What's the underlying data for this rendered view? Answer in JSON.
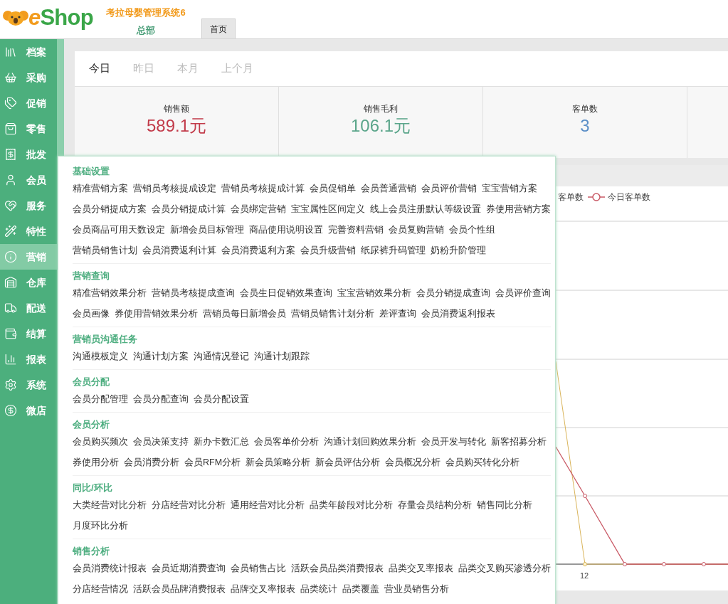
{
  "header": {
    "logo": {
      "accent": "e",
      "name": "Shop"
    },
    "system_title": "考拉母婴管理系统6",
    "branch": "总部",
    "tabs": [
      {
        "label": "首页",
        "selected": true
      }
    ]
  },
  "sidebar": {
    "items": [
      {
        "label": "档案",
        "selected": false
      },
      {
        "label": "采购",
        "selected": false
      },
      {
        "label": "促销",
        "selected": false
      },
      {
        "label": "零售",
        "selected": false
      },
      {
        "label": "批发",
        "selected": false
      },
      {
        "label": "会员",
        "selected": false
      },
      {
        "label": "服务",
        "selected": false
      },
      {
        "label": "特性",
        "selected": false
      },
      {
        "label": "营销",
        "selected": true
      },
      {
        "label": "仓库",
        "selected": false
      },
      {
        "label": "配送",
        "selected": false
      },
      {
        "label": "结算",
        "selected": false
      },
      {
        "label": "报表",
        "selected": false
      },
      {
        "label": "系统",
        "selected": false
      },
      {
        "label": "微店",
        "selected": false
      }
    ]
  },
  "periods": [
    {
      "label": "今日",
      "selected": true
    },
    {
      "label": "昨日",
      "selected": false
    },
    {
      "label": "本月",
      "selected": false
    },
    {
      "label": "上个月",
      "selected": false
    }
  ],
  "stats": [
    {
      "label": "销售额",
      "value": "589.1元",
      "color": "#c23b4a"
    },
    {
      "label": "销售毛利",
      "value": "106.1元",
      "color": "#5aa58a"
    },
    {
      "label": "客单数",
      "value": "3",
      "color": "#5b8fc7"
    }
  ],
  "chart": {
    "legend": [
      {
        "label": "客单数",
        "color": "#d9b45a"
      },
      {
        "label": "今日客单数",
        "color": "#c95a66"
      }
    ],
    "x_tick": "12"
  },
  "menu": {
    "sections": [
      {
        "title": "基础设置",
        "lines": [
          [
            "精准营销方案",
            "营销员考核提成设定",
            "营销员考核提成计算",
            "会员促销单",
            "会员普通营销",
            "会员评价营销",
            "宝宝营销方案"
          ],
          [
            "会员分销提成方案",
            "会员分销提成计算",
            "会员绑定营销",
            "宝宝属性区间定义",
            "线上会员注册默认等级设置",
            "券使用营销方案"
          ],
          [
            "会员商品可用天数设定",
            "新增会员目标管理",
            "商品使用说明设置",
            "完善资料营销",
            "会员复购营销",
            "会员个性组"
          ],
          [
            "营销员销售计划",
            "会员消费返利计算",
            "会员消费返利方案",
            "会员升级营销",
            "纸尿裤升码管理",
            "奶粉升阶管理"
          ]
        ]
      },
      {
        "title": "营销查询",
        "lines": [
          [
            "精准营销效果分析",
            "营销员考核提成查询",
            "会员生日促销效果查询",
            "宝宝营销效果分析",
            "会员分销提成查询",
            "会员评价查询"
          ],
          [
            "会员画像",
            "券使用营销效果分析",
            "营销员每日新增会员",
            "营销员销售计划分析",
            "差评查询",
            "会员消费返利报表"
          ]
        ]
      },
      {
        "title": "营销员沟通任务",
        "lines": [
          [
            "沟通模板定义",
            "沟通计划方案",
            "沟通情况登记",
            "沟通计划跟踪"
          ]
        ]
      },
      {
        "title": "会员分配",
        "lines": [
          [
            "会员分配管理",
            "会员分配查询",
            "会员分配设置"
          ]
        ]
      },
      {
        "title": "会员分析",
        "lines": [
          [
            "会员购买频次",
            "会员决策支持",
            "新办卡数汇总",
            "会员客单价分析",
            "沟通计划回购效果分析",
            "会员开发与转化",
            "新客招募分析"
          ],
          [
            "券使用分析",
            "会员消费分析",
            "会员RFM分析",
            "新会员策略分析",
            "新会员评估分析",
            "会员概况分析",
            "会员购买转化分析"
          ]
        ]
      },
      {
        "title": "同比/环比",
        "lines": [
          [
            "大类经营对比分析",
            "分店经营对比分析",
            "通用经营对比分析",
            "品类年龄段对比分析",
            "存量会员结构分析",
            "销售同比分析"
          ],
          [
            "月度环比分析"
          ]
        ]
      },
      {
        "title": "销售分析",
        "lines": [
          [
            "会员消费统计报表",
            "会员近期消费查询",
            "会员销售占比",
            "活跃会员品类消费报表",
            "品类交叉率报表",
            "品类交叉购买渗透分析"
          ],
          [
            "分店经营情况",
            "活跃会员品牌消费报表",
            "品牌交叉率报表",
            "品类统计",
            "品类覆盖",
            "营业员销售分析"
          ]
        ]
      }
    ]
  }
}
